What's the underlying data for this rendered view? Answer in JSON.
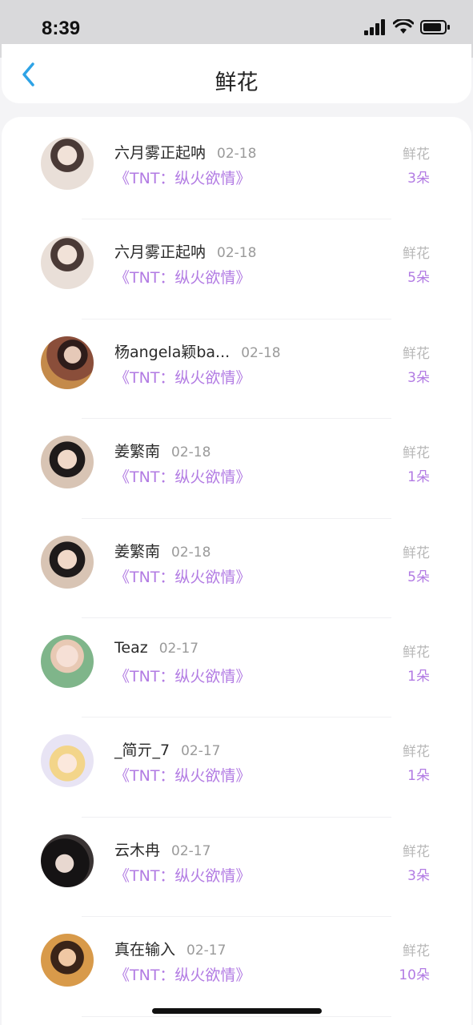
{
  "status_bar": {
    "time": "8:39"
  },
  "header": {
    "title": "鲜花"
  },
  "list": [
    {
      "name": "六月雾正起呐",
      "date": "02-18",
      "work": "《TNT：纵火欲情》",
      "gift_label": "鲜花",
      "gift_count": "3朵"
    },
    {
      "name": "六月雾正起呐",
      "date": "02-18",
      "work": "《TNT：纵火欲情》",
      "gift_label": "鲜花",
      "gift_count": "5朵"
    },
    {
      "name": "杨angela颖ba...",
      "date": "02-18",
      "work": "《TNT：纵火欲情》",
      "gift_label": "鲜花",
      "gift_count": "3朵"
    },
    {
      "name": "姜繁南",
      "date": "02-18",
      "work": "《TNT：纵火欲情》",
      "gift_label": "鲜花",
      "gift_count": "1朵"
    },
    {
      "name": "姜繁南",
      "date": "02-18",
      "work": "《TNT：纵火欲情》",
      "gift_label": "鲜花",
      "gift_count": "5朵"
    },
    {
      "name": "Teaz",
      "date": "02-17",
      "work": "《TNT：纵火欲情》",
      "gift_label": "鲜花",
      "gift_count": "1朵"
    },
    {
      "name": "_简亓_7",
      "date": "02-17",
      "work": "《TNT：纵火欲情》",
      "gift_label": "鲜花",
      "gift_count": "1朵"
    },
    {
      "name": "云木冉",
      "date": "02-17",
      "work": "《TNT：纵火欲情》",
      "gift_label": "鲜花",
      "gift_count": "3朵"
    },
    {
      "name": "真在输入",
      "date": "02-17",
      "work": "《TNT：纵火欲情》",
      "gift_label": "鲜花",
      "gift_count": "10朵"
    }
  ],
  "colors": {
    "accent": "#b27be3",
    "back_icon": "#2ea3e6"
  }
}
